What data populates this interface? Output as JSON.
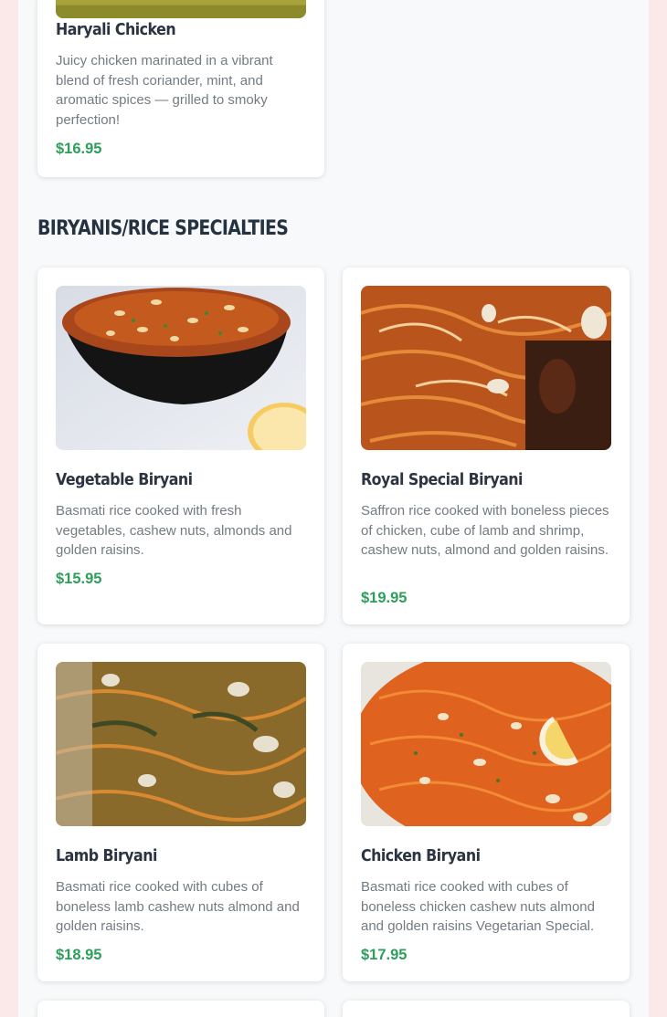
{
  "colors": {
    "background": "#fbe9ea",
    "panel": "#f8f9fa",
    "title": "#253241",
    "description": "#737b83",
    "price": "#2e9e5b"
  },
  "previous_item": {
    "name": "Haryali Chicken",
    "description": "Juicy chicken marinated in a vibrant blend of fresh coriander, mint, and aromatic spices — grilled to smoky perfection!",
    "price": "$16.95"
  },
  "section": {
    "title": "BIRYANIS/RICE SPECIALTIES"
  },
  "items": [
    {
      "name": "Vegetable Biryani",
      "description": "Basmati rice cooked with fresh vegetables, cashew nuts, almonds and golden raisins.",
      "price": "$15.95",
      "image": "vegetable-biryani-photo"
    },
    {
      "name": "Royal Special Biryani",
      "description": "Saffron rice cooked with boneless pieces of chicken, cube of lamb and shrimp, cashew nuts, almond and golden raisins.",
      "price": "$19.95",
      "image": "royal-special-biryani-photo"
    },
    {
      "name": "Lamb Biryani",
      "description": "Basmati rice cooked with cubes of boneless lamb cashew nuts almond and golden raisins.",
      "price": "$18.95",
      "image": "lamb-biryani-photo"
    },
    {
      "name": "Chicken Biryani",
      "description": "Basmati rice cooked with cubes of boneless chicken cashew nuts almond and golden raisins Vegetarian Special.",
      "price": "$17.95",
      "image": "chicken-biryani-photo"
    }
  ]
}
